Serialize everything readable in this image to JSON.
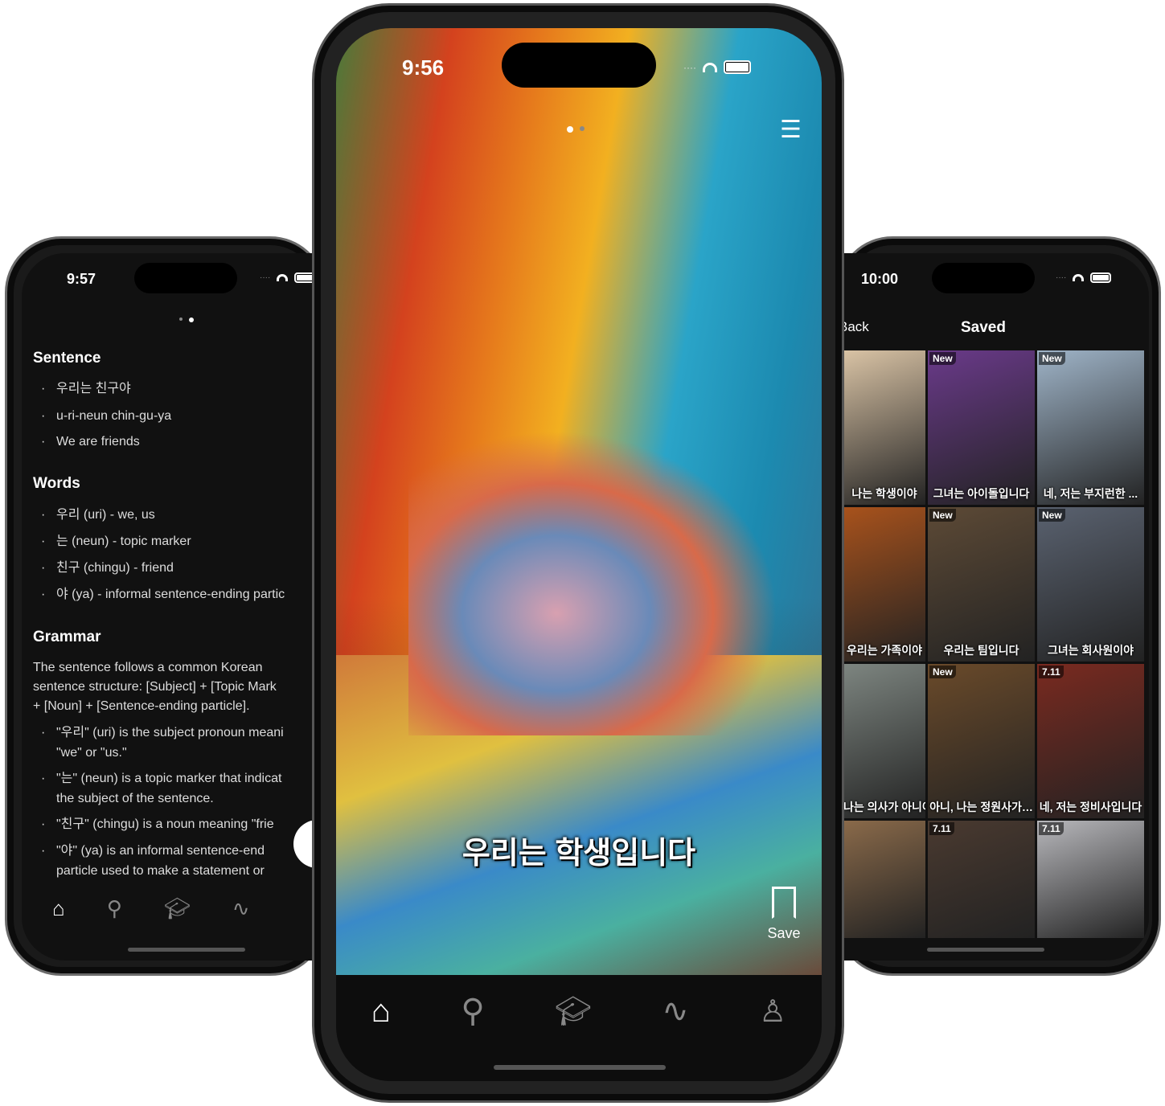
{
  "left_phone": {
    "time": "9:57",
    "sections": {
      "sentence": {
        "title": "Sentence",
        "items": [
          "우리는 친구야",
          "u-ri-neun chin-gu-ya",
          "We are friends"
        ]
      },
      "words": {
        "title": "Words",
        "items": [
          "우리 (uri) - we, us",
          "는 (neun) - topic marker",
          "친구 (chingu) - friend",
          "야 (ya) - informal sentence-ending partic"
        ]
      },
      "grammar": {
        "title": "Grammar",
        "intro": [
          "The sentence follows a common Korean",
          "sentence structure: [Subject] + [Topic Mark",
          "+ [Noun] + [Sentence-ending particle]."
        ],
        "items": [
          [
            "\"우리\" (uri) is the subject pronoun meani",
            "\"we\" or \"us.\""
          ],
          [
            "\"는\" (neun) is a topic marker that indicat",
            "the subject of the sentence."
          ],
          [
            "\"친구\" (chingu) is a noun meaning \"frie"
          ],
          [
            "\"야\" (ya) is an informal sentence-end",
            "particle used to make a statement or"
          ]
        ]
      }
    }
  },
  "center_phone": {
    "time": "9:56",
    "subtitle": "우리는 학생입니다",
    "save_label": "Save",
    "page_dots": 2,
    "active_dot": 0
  },
  "right_phone": {
    "time": "10:00",
    "back_label": "Back",
    "title": "Saved",
    "cells": [
      {
        "badge": "",
        "caption": "나는 학생이야",
        "color": "#d9c3a5"
      },
      {
        "badge": "New",
        "caption": "그녀는 아이돌입니다",
        "color": "#6a3a8a"
      },
      {
        "badge": "New",
        "caption": "네, 저는 부지런한 ...",
        "color": "#9fb4c8"
      },
      {
        "badge": "",
        "caption": "우리는 가족이야",
        "color": "#a8521c"
      },
      {
        "badge": "New",
        "caption": "우리는 팀입니다",
        "color": "#5d4a36"
      },
      {
        "badge": "New",
        "caption": "그녀는 회사원이야",
        "color": "#5a6270"
      },
      {
        "badge": "",
        "caption": "나는 의사가 아니야",
        "color": "#7d8580"
      },
      {
        "badge": "New",
        "caption": "아니, 나는 정원사가…",
        "color": "#6a4a2a"
      },
      {
        "badge": "7.11",
        "caption": "네, 저는 정비사입니다",
        "color": "#7a2a20"
      },
      {
        "badge": "",
        "caption": "",
        "color": "#8a6a4a"
      },
      {
        "badge": "7.11",
        "caption": "",
        "color": "#4a3a30"
      },
      {
        "badge": "7.11",
        "caption": "",
        "color": "#b8b8bc"
      }
    ]
  },
  "tabbar": {
    "icons": [
      "home-icon",
      "search-icon",
      "learn-icon",
      "path-icon",
      "profile-icon"
    ]
  }
}
